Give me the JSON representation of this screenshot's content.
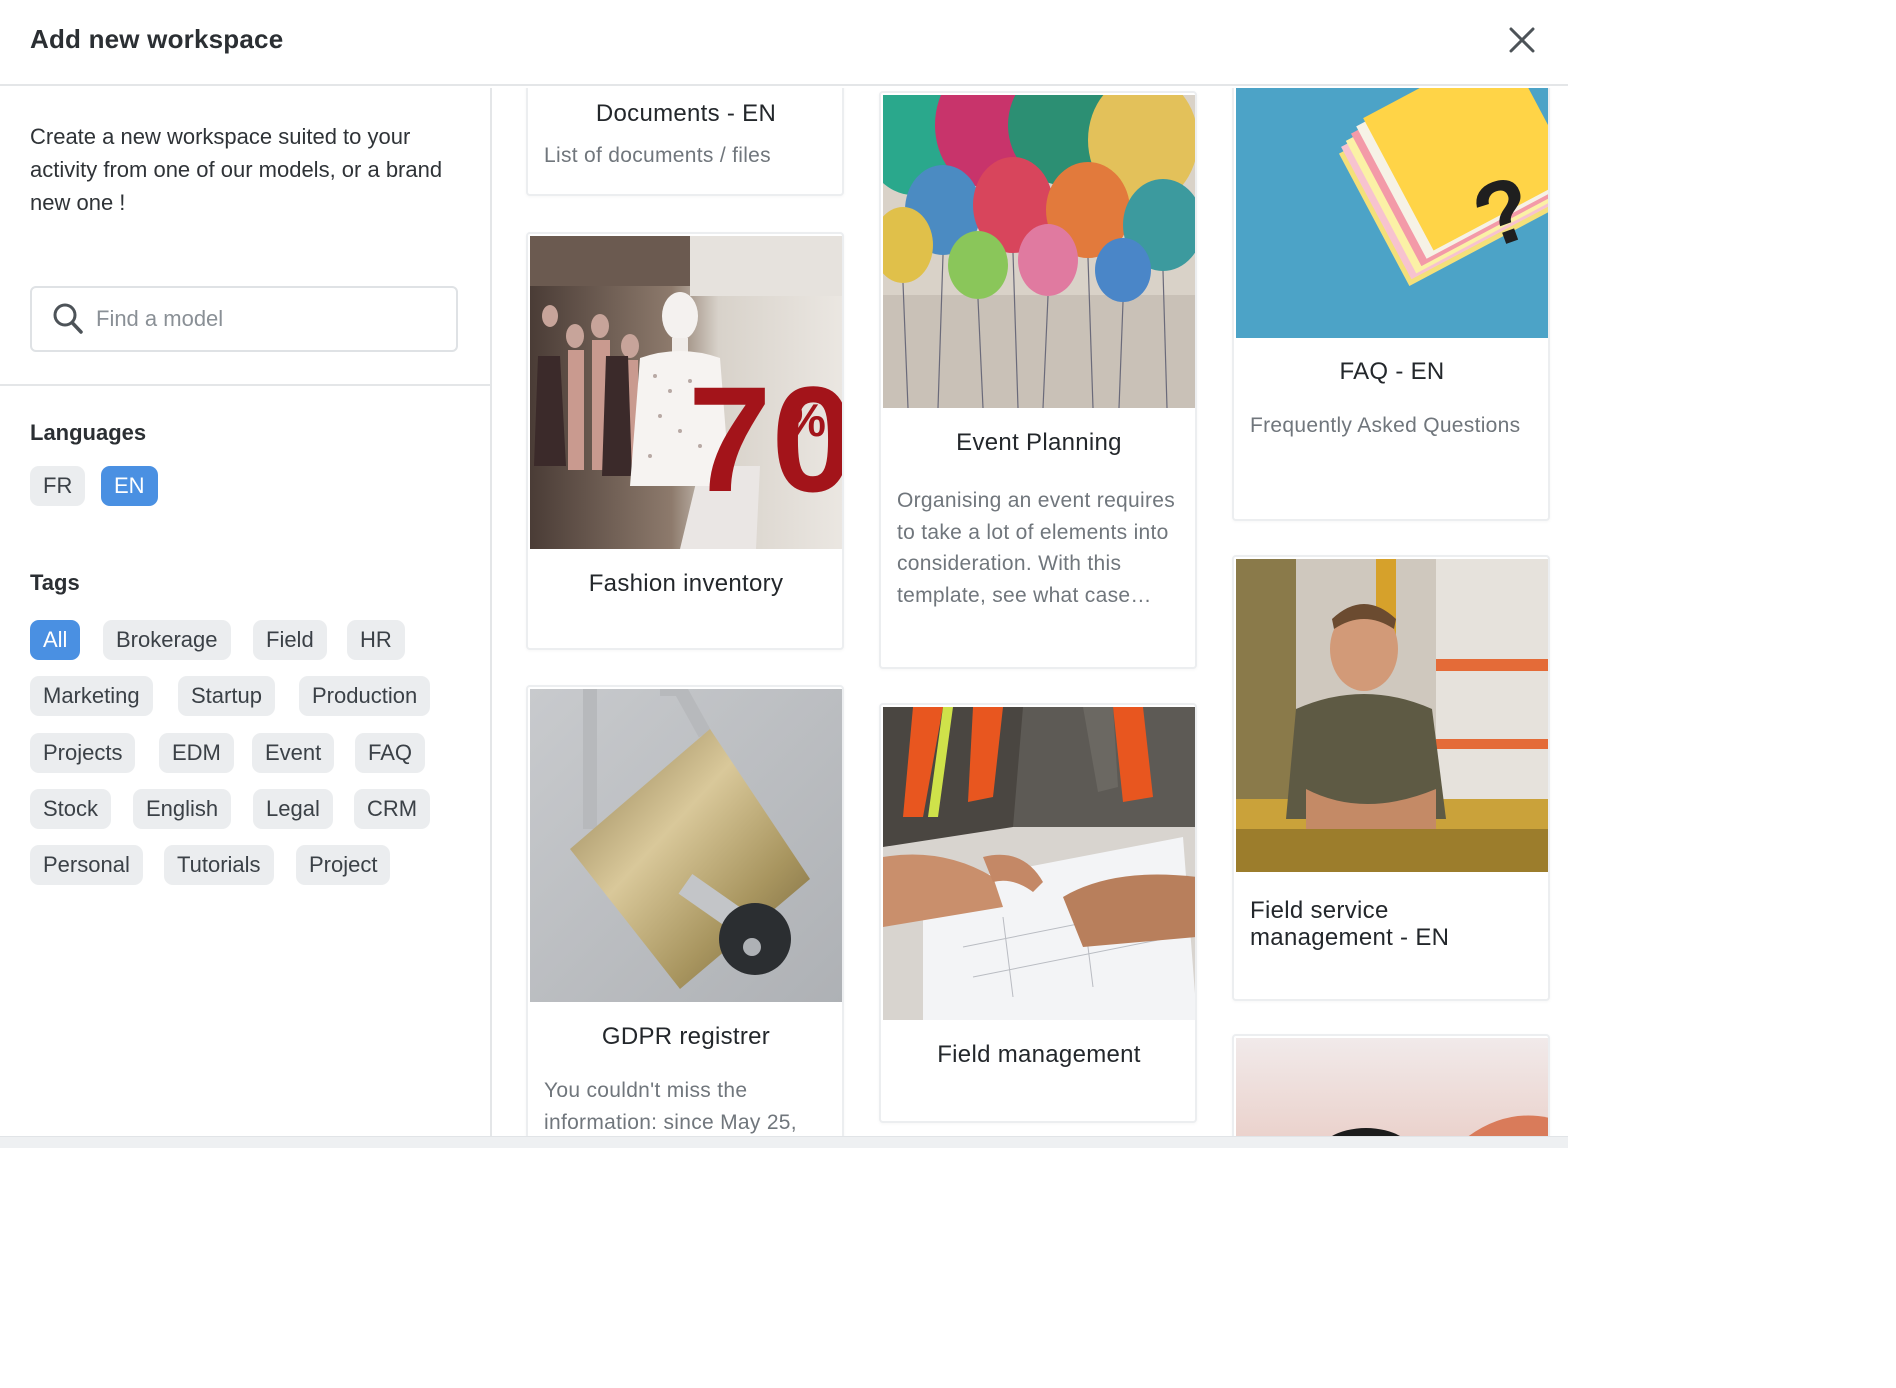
{
  "dialog": {
    "title": "Add new workspace",
    "close_icon": "close-icon"
  },
  "sidebar": {
    "intro": "Create a new workspace suited to your activity from one of our models, or a brand new one !",
    "search": {
      "placeholder": "Find a model",
      "value": ""
    },
    "languages_title": "Languages",
    "languages": [
      {
        "label": "FR",
        "active": false
      },
      {
        "label": "EN",
        "active": true
      }
    ],
    "tags_title": "Tags",
    "tags": [
      {
        "label": "All",
        "active": true
      },
      {
        "label": "Brokerage",
        "active": false
      },
      {
        "label": "Field",
        "active": false
      },
      {
        "label": "HR",
        "active": false
      },
      {
        "label": "Marketing",
        "active": false
      },
      {
        "label": "Startup",
        "active": false
      },
      {
        "label": "Production",
        "active": false
      },
      {
        "label": "Projects",
        "active": false
      },
      {
        "label": "EDM",
        "active": false
      },
      {
        "label": "Event",
        "active": false
      },
      {
        "label": "FAQ",
        "active": false
      },
      {
        "label": "Stock",
        "active": false
      },
      {
        "label": "English",
        "active": false
      },
      {
        "label": "Legal",
        "active": false
      },
      {
        "label": "CRM",
        "active": false
      },
      {
        "label": "Personal",
        "active": false
      },
      {
        "label": "Tutorials",
        "active": false
      },
      {
        "label": "Project",
        "active": false
      }
    ]
  },
  "cards": {
    "documents": {
      "title": "Documents - EN",
      "description": "List of documents / files"
    },
    "fashion": {
      "title": "Fashion inventory",
      "image": "mannequins-sale-photo"
    },
    "gdpr": {
      "title": "GDPR registrer",
      "description": "You couldn't miss the information: since May 25,",
      "image": "padlock-key-photo"
    },
    "event": {
      "title": "Event Planning",
      "description": "Organising an event requires to take a lot of elements into consideration. With this template, see what case…",
      "image": "balloons-photo"
    },
    "field": {
      "title": "Field management",
      "image": "workers-blueprint-photo"
    },
    "faq": {
      "title": "FAQ - EN",
      "description": "Frequently Asked Questions",
      "image": "sticky-notes-question-photo"
    },
    "fsm": {
      "title": "Field service management - EN",
      "image": "warehouse-man-photo"
    },
    "partial": {
      "image": "sunset-photo"
    }
  },
  "colors": {
    "accent": "#4a90e2",
    "chip_bg": "#ebedef",
    "border": "#e4e6e8"
  }
}
